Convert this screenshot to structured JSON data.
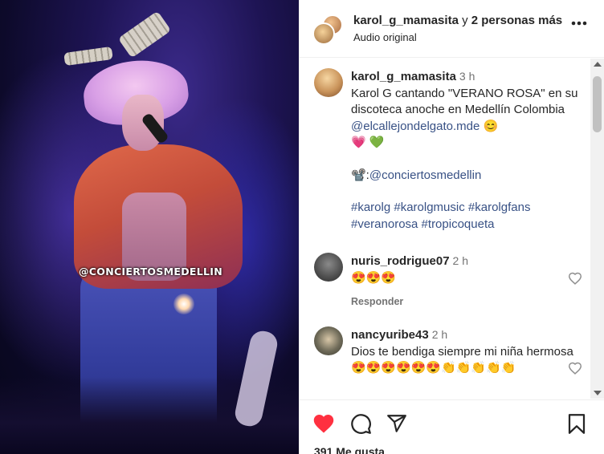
{
  "media": {
    "watermark": "@CONCIERTOSMEDELLIN"
  },
  "header": {
    "username": "karol_g_mamasita",
    "connector": " y ",
    "others": "2 personas más",
    "audio": "Audio original",
    "more_icon": "more-horizontal-icon"
  },
  "caption": {
    "username": "karol_g_mamasita",
    "time": "3 h",
    "text_line1": "Karol G cantando \"VERANO ROSA\" en su discoteca anoche en Medellín Colombia ",
    "mention": "@elcallejondelgato.mde",
    "emojis1": " 😊",
    "emojis2": "💗 💚",
    "credit_prefix": "📽️:",
    "credit_mention": "@conciertosmedellin",
    "hashtags_line1": "#karolg #karolgmusic #karolgfans",
    "hashtags_line2": "#veranorosa #tropicoqueta"
  },
  "comments": [
    {
      "username": "nuris_rodrigue07",
      "time": "2 h",
      "text": "😍😍😍",
      "reply_label": "Responder"
    },
    {
      "username": "nancyuribe43",
      "time": "2 h",
      "text": "Dios te bendiga siempre mi niña hermosa 😍😍😍😍😍😍👏👏👏👏👏",
      "reply_label": ""
    }
  ],
  "actions": {
    "liked": true,
    "like_color": "#ff3040",
    "likes_text": "391 Me gusta"
  }
}
